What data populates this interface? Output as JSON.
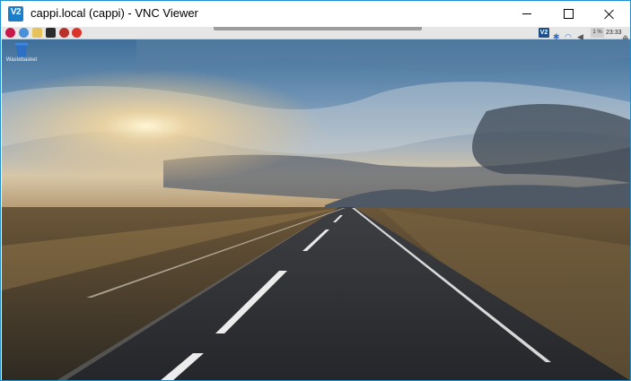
{
  "window": {
    "title": "cappi.local (cappi) - VNC Viewer",
    "app_icon_text": "V2",
    "controls": [
      "minimize",
      "maximize",
      "close"
    ]
  },
  "taskbar": {
    "launchers": [
      "raspberry-menu",
      "web-browser",
      "file-manager",
      "terminal",
      "bug-app",
      "mathematica"
    ],
    "tray": {
      "vnc_label": "V2",
      "cpu_label": "1 %",
      "clock": "23:33"
    }
  },
  "desktop": {
    "icons": [
      {
        "label": "Wastebasket",
        "icon": "trash-icon"
      }
    ],
    "wallpaper": "sunset-road"
  },
  "colors": {
    "window_border": "#1e90d0",
    "title_text": "#000000",
    "taskbar_bg": "#e6e6e6"
  }
}
